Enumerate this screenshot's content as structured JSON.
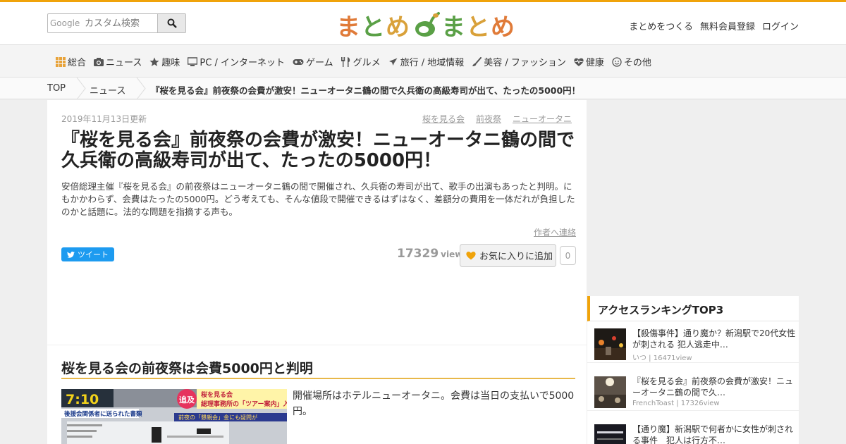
{
  "header": {
    "search_brand": "Google",
    "search_placeholder": "カスタム検索",
    "logo_chars": [
      "ま",
      "と",
      "め",
      "",
      "ま",
      "と",
      "め"
    ],
    "links": [
      "まとめをつくる",
      "無料会員登録",
      "ログイン"
    ]
  },
  "nav": {
    "items": [
      {
        "label": "総合",
        "icon": "grid-icon"
      },
      {
        "label": "ニュース",
        "icon": "camera-icon"
      },
      {
        "label": "趣味",
        "icon": "star-icon"
      },
      {
        "label": "PC / インターネット",
        "icon": "monitor-icon"
      },
      {
        "label": "ゲーム",
        "icon": "gamepad-icon"
      },
      {
        "label": "グルメ",
        "icon": "utensils-icon"
      },
      {
        "label": "旅行 / 地域情報",
        "icon": "plane-icon"
      },
      {
        "label": "美容 / ファッション",
        "icon": "brush-icon"
      },
      {
        "label": "健康",
        "icon": "heart-pulse-icon"
      },
      {
        "label": "その他",
        "icon": "smile-icon"
      }
    ]
  },
  "breadcrumb": {
    "top": "TOP",
    "category": "ニュース",
    "current": "『桜を見る会』前夜祭の会費が激安！ニューオータニ鶴の間で久兵衛の高級寿司が出て、たったの5000円！"
  },
  "article": {
    "date": "2019年11月13日更新",
    "tags": [
      "桜を見る会",
      "前夜祭",
      "ニューオータニ"
    ],
    "title": "『桜を見る会』前夜祭の会費が激安！ニューオータニ鶴の間で久兵衛の高級寿司が出て、たったの5000円！",
    "lead": "安倍総理主催『桜を見る会』の前夜祭はニューオータニ鶴の間で開催され、久兵衛の寿司が出て、歌手の出演もあったと判明。にもかかわらず、会費はたったの5000円。どう考えても、そんな値段で開催できるはずはなく、差額分の費用を一体だれが負担したのかと話題に。法的な問題を指摘する声も。",
    "contact_author": "作者へ連絡",
    "tweet_label": "ツイート",
    "views": "17329",
    "views_unit": "view",
    "favorite_label": "お気に入りに追加",
    "favorite_count": "0",
    "section_title": "桜を見る会の前夜祭は会費5000円と判明",
    "section_text": "開催場所はホテルニューオータニ。会費は当日の支払いで5000円。",
    "thumb": {
      "time": "7:10",
      "small1": "桜を見る会",
      "small2": "総理事務所の「ツアー案内」入手",
      "tag": "追及",
      "strip": "後援会関係者に送られた書類",
      "note": "前夜の「懇親会」金にも疑問が"
    }
  },
  "ranking": {
    "title": "アクセスランキングTOP3",
    "items": [
      {
        "title": "【殺傷事件】通り魔か？新潟駅で20代女性が刺される 犯人逃走中…",
        "meta": "いつ | 16471view"
      },
      {
        "title": "『桜を見る会』前夜祭の会費が激安！ニューオータニ鶴の間で久…",
        "meta": "FrenchToast | 17326view"
      },
      {
        "title": "【通り魔】新潟駅で何者かに女性が刺される事件　犯人は行方不…",
        "meta": ""
      }
    ]
  },
  "colors": {
    "accent": "#f0a30a",
    "tweet": "#1d9bf0",
    "section_underline": "#e8b84a"
  }
}
